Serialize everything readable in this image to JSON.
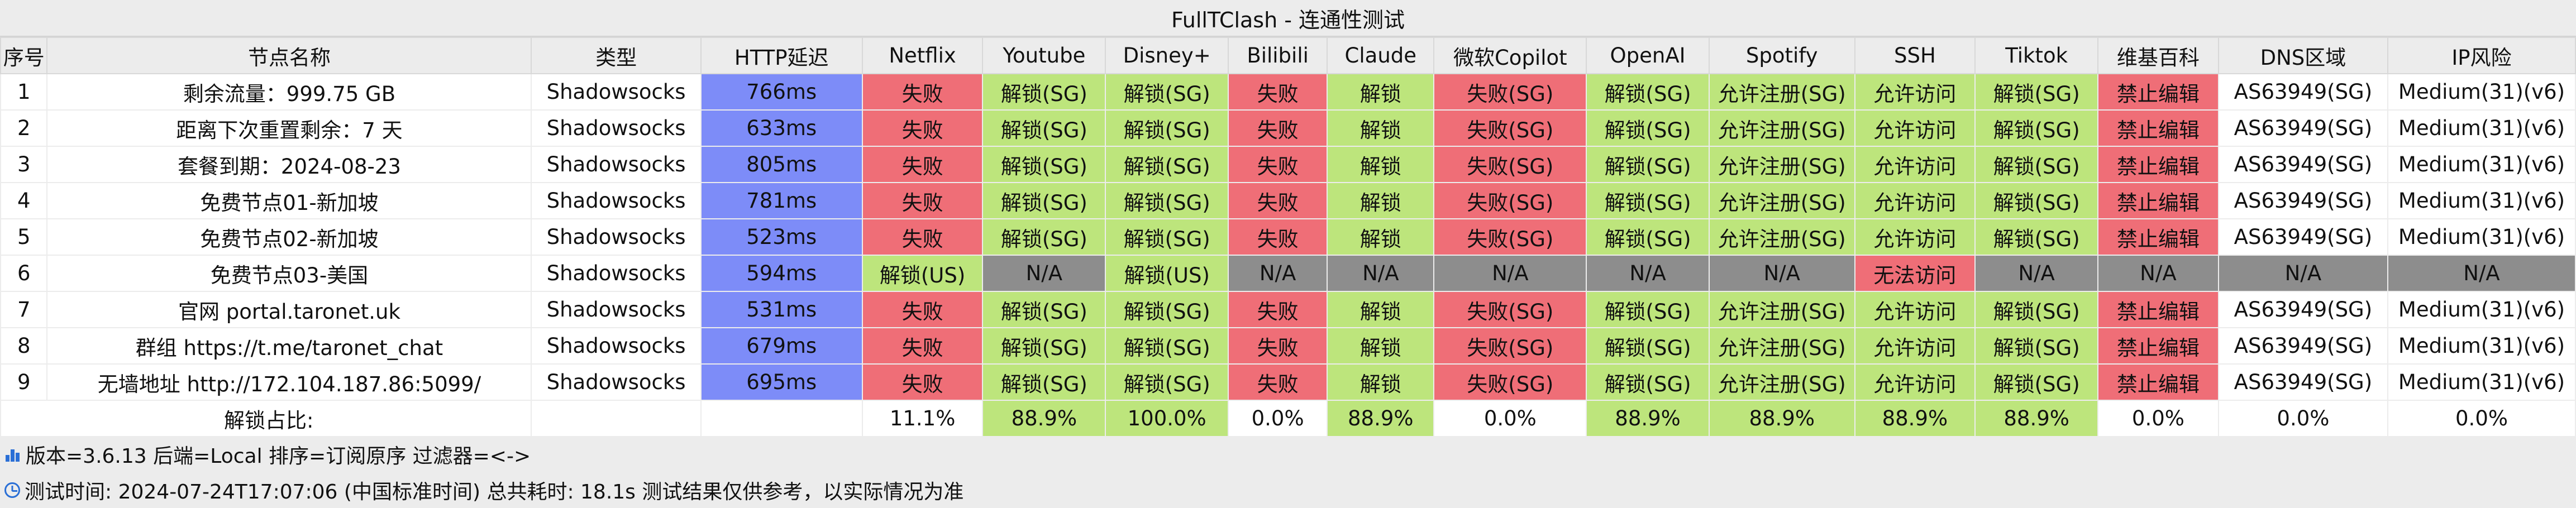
{
  "title": "FullTClash - 连通性测试",
  "headers": [
    "序号",
    "节点名称",
    "类型",
    "HTTP延迟",
    "Netflix",
    "Youtube",
    "Disney+",
    "Bilibili",
    "Claude",
    "微软Copilot",
    "OpenAI",
    "Spotify",
    "SSH",
    "Tiktok",
    "维基百科",
    "DNS区域",
    "IP风险"
  ],
  "rows": [
    {
      "idx": "1",
      "name": "剩余流量：999.75 GB",
      "type": "Shadowsocks",
      "latency": "766ms",
      "netflix": "失败",
      "youtube": "解锁(SG)",
      "disney": "解锁(SG)",
      "bilibili": "失败",
      "claude": "解锁",
      "copilot": "失败(SG)",
      "openai": "解锁(SG)",
      "spotify": "允许注册(SG)",
      "ssh": "允许访问",
      "tiktok": "解锁(SG)",
      "wiki": "禁止编辑",
      "dns": "AS63949(SG)",
      "iprisk": "Medium(31)(v6)"
    },
    {
      "idx": "2",
      "name": "距离下次重置剩余：7 天",
      "type": "Shadowsocks",
      "latency": "633ms",
      "netflix": "失败",
      "youtube": "解锁(SG)",
      "disney": "解锁(SG)",
      "bilibili": "失败",
      "claude": "解锁",
      "copilot": "失败(SG)",
      "openai": "解锁(SG)",
      "spotify": "允许注册(SG)",
      "ssh": "允许访问",
      "tiktok": "解锁(SG)",
      "wiki": "禁止编辑",
      "dns": "AS63949(SG)",
      "iprisk": "Medium(31)(v6)"
    },
    {
      "idx": "3",
      "name": "套餐到期：2024-08-23",
      "type": "Shadowsocks",
      "latency": "805ms",
      "netflix": "失败",
      "youtube": "解锁(SG)",
      "disney": "解锁(SG)",
      "bilibili": "失败",
      "claude": "解锁",
      "copilot": "失败(SG)",
      "openai": "解锁(SG)",
      "spotify": "允许注册(SG)",
      "ssh": "允许访问",
      "tiktok": "解锁(SG)",
      "wiki": "禁止编辑",
      "dns": "AS63949(SG)",
      "iprisk": "Medium(31)(v6)"
    },
    {
      "idx": "4",
      "name": "免费节点01-新加坡",
      "type": "Shadowsocks",
      "latency": "781ms",
      "netflix": "失败",
      "youtube": "解锁(SG)",
      "disney": "解锁(SG)",
      "bilibili": "失败",
      "claude": "解锁",
      "copilot": "失败(SG)",
      "openai": "解锁(SG)",
      "spotify": "允许注册(SG)",
      "ssh": "允许访问",
      "tiktok": "解锁(SG)",
      "wiki": "禁止编辑",
      "dns": "AS63949(SG)",
      "iprisk": "Medium(31)(v6)"
    },
    {
      "idx": "5",
      "name": "免费节点02-新加坡",
      "type": "Shadowsocks",
      "latency": "523ms",
      "netflix": "失败",
      "youtube": "解锁(SG)",
      "disney": "解锁(SG)",
      "bilibili": "失败",
      "claude": "解锁",
      "copilot": "失败(SG)",
      "openai": "解锁(SG)",
      "spotify": "允许注册(SG)",
      "ssh": "允许访问",
      "tiktok": "解锁(SG)",
      "wiki": "禁止编辑",
      "dns": "AS63949(SG)",
      "iprisk": "Medium(31)(v6)"
    },
    {
      "idx": "6",
      "name": "免费节点03-美国",
      "type": "Shadowsocks",
      "latency": "594ms",
      "netflix": "解锁(US)",
      "youtube": "N/A",
      "disney": "解锁(US)",
      "bilibili": "N/A",
      "claude": "N/A",
      "copilot": "N/A",
      "openai": "N/A",
      "spotify": "N/A",
      "ssh": "无法访问",
      "tiktok": "N/A",
      "wiki": "N/A",
      "dns": "N/A",
      "iprisk": "N/A"
    },
    {
      "idx": "7",
      "name": "官网 portal.taronet.uk",
      "type": "Shadowsocks",
      "latency": "531ms",
      "netflix": "失败",
      "youtube": "解锁(SG)",
      "disney": "解锁(SG)",
      "bilibili": "失败",
      "claude": "解锁",
      "copilot": "失败(SG)",
      "openai": "解锁(SG)",
      "spotify": "允许注册(SG)",
      "ssh": "允许访问",
      "tiktok": "解锁(SG)",
      "wiki": "禁止编辑",
      "dns": "AS63949(SG)",
      "iprisk": "Medium(31)(v6)"
    },
    {
      "idx": "8",
      "name": "群组 https://t.me/taronet_chat",
      "type": "Shadowsocks",
      "latency": "679ms",
      "netflix": "失败",
      "youtube": "解锁(SG)",
      "disney": "解锁(SG)",
      "bilibili": "失败",
      "claude": "解锁",
      "copilot": "失败(SG)",
      "openai": "解锁(SG)",
      "spotify": "允许注册(SG)",
      "ssh": "允许访问",
      "tiktok": "解锁(SG)",
      "wiki": "禁止编辑",
      "dns": "AS63949(SG)",
      "iprisk": "Medium(31)(v6)"
    },
    {
      "idx": "9",
      "name": "无墙地址 http://172.104.187.86:5099/",
      "type": "Shadowsocks",
      "latency": "695ms",
      "netflix": "失败",
      "youtube": "解锁(SG)",
      "disney": "解锁(SG)",
      "bilibili": "失败",
      "claude": "解锁",
      "copilot": "失败(SG)",
      "openai": "解锁(SG)",
      "spotify": "允许注册(SG)",
      "ssh": "允许访问",
      "tiktok": "解锁(SG)",
      "wiki": "禁止编辑",
      "dns": "AS63949(SG)",
      "iprisk": "Medium(31)(v6)"
    }
  ],
  "summary": {
    "label": "解锁占比:",
    "netflix": "11.1%",
    "youtube": "88.9%",
    "disney": "100.0%",
    "bilibili": "0.0%",
    "claude": "88.9%",
    "copilot": "0.0%",
    "openai": "88.9%",
    "spotify": "88.9%",
    "ssh": "88.9%",
    "tiktok": "88.9%",
    "wiki": "0.0%",
    "dns": "0.0%",
    "iprisk": "0.0%"
  },
  "footer": {
    "version_line": "版本=3.6.13  后端=Local  排序=订阅原序  过滤器=<->",
    "time_line": "测试时间: 2024-07-24T17:07:06 (中国标准时间) 总共耗时: 18.1s 测试结果仅供参考，以实际情况为准"
  },
  "icons": {
    "version": "bar-chart-icon",
    "time": "clock-icon"
  },
  "colors": {
    "header_bg": "#ececec",
    "latency": "#7d8cf8",
    "fail": "#ef6e77",
    "unlock": "#bde57c",
    "na": "#8d8d8d",
    "icon": "#2a6fd6"
  }
}
